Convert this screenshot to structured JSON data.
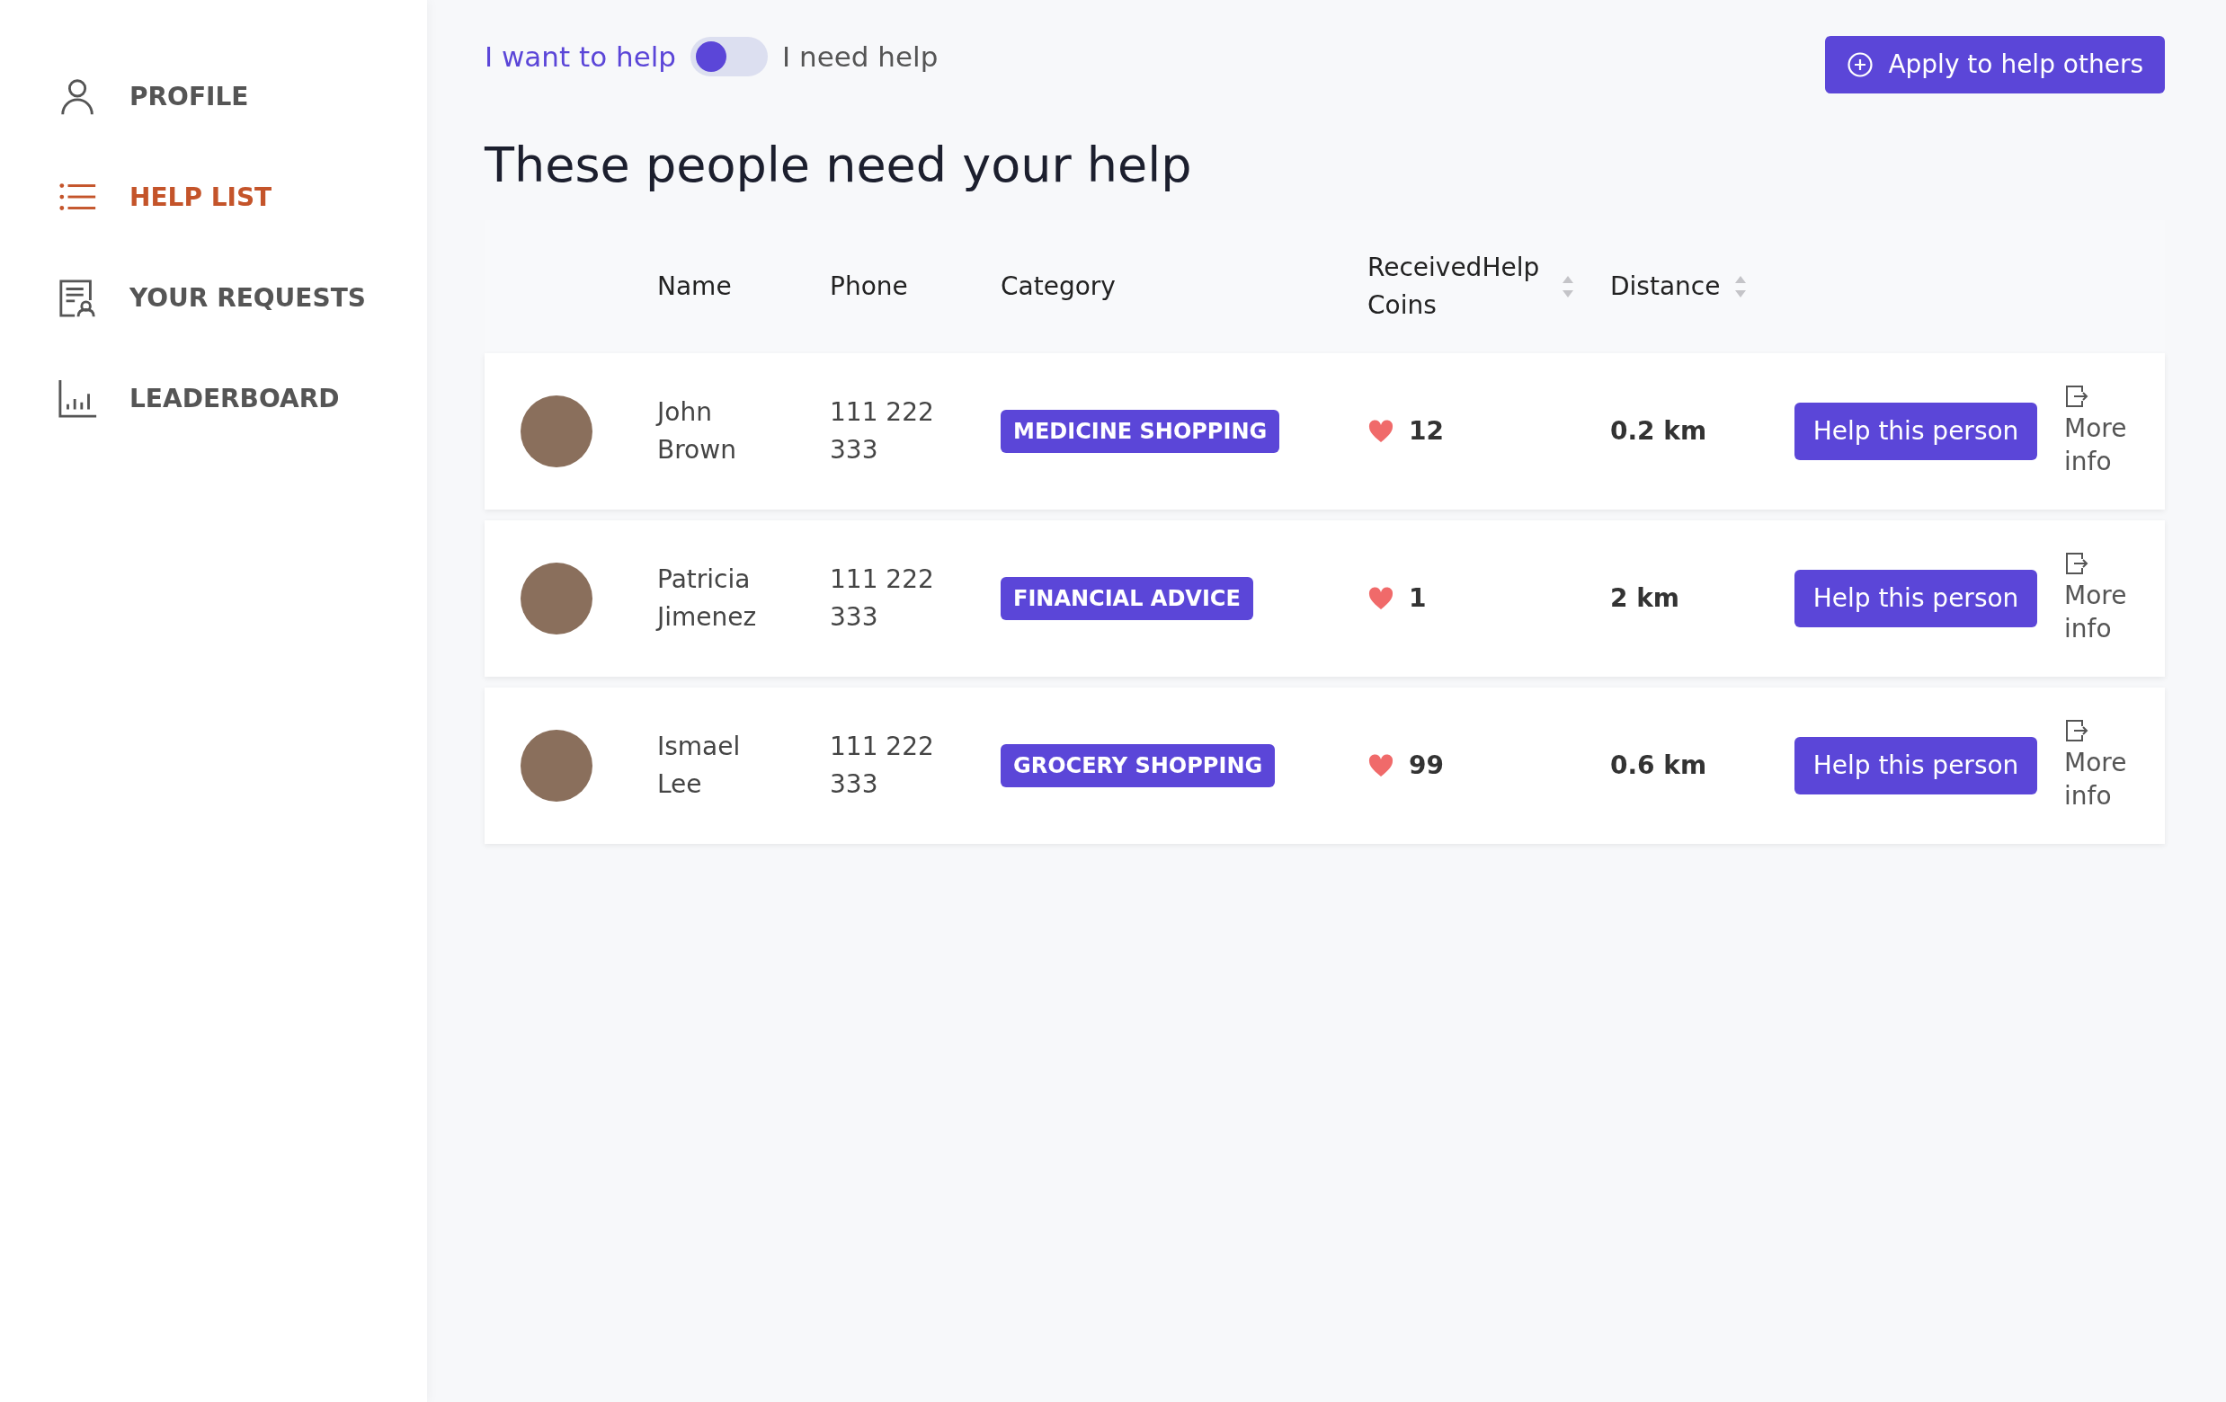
{
  "sidebar": {
    "items": [
      {
        "label": "PROFILE",
        "selected": false
      },
      {
        "label": "HELP LIST",
        "selected": true
      },
      {
        "label": "YOUR REQUESTS",
        "selected": false
      },
      {
        "label": "LEADERBOARD",
        "selected": false
      }
    ]
  },
  "mode_toggle": {
    "left_label": "I want to help",
    "right_label": "I need help",
    "on": false
  },
  "apply_button": {
    "label": "Apply to help others"
  },
  "heading": "These people need your help",
  "table": {
    "columns": [
      {
        "label": "Name",
        "sortable": false
      },
      {
        "label": "Phone",
        "sortable": false
      },
      {
        "label": "Category",
        "sortable": false
      },
      {
        "label": "ReceivedHelp Coins",
        "sortable": true
      },
      {
        "label": "Distance",
        "sortable": true
      }
    ],
    "rows": [
      {
        "name": "John Brown",
        "phone": "111 222 333",
        "category": "MEDICINE SHOPPING",
        "coins": "12",
        "distance": "0.2 km",
        "action": "Help this person",
        "more": "More info"
      },
      {
        "name": "Patricia Jimenez",
        "phone": "111 222 333",
        "category": "FINANCIAL ADVICE",
        "coins": "1",
        "distance": "2 km",
        "action": "Help this person",
        "more": "More info"
      },
      {
        "name": "Ismael Lee",
        "phone": "111 222 333",
        "category": "GROCERY SHOPPING",
        "coins": "99",
        "distance": "0.6 km",
        "action": "Help this person",
        "more": "More info"
      }
    ]
  }
}
